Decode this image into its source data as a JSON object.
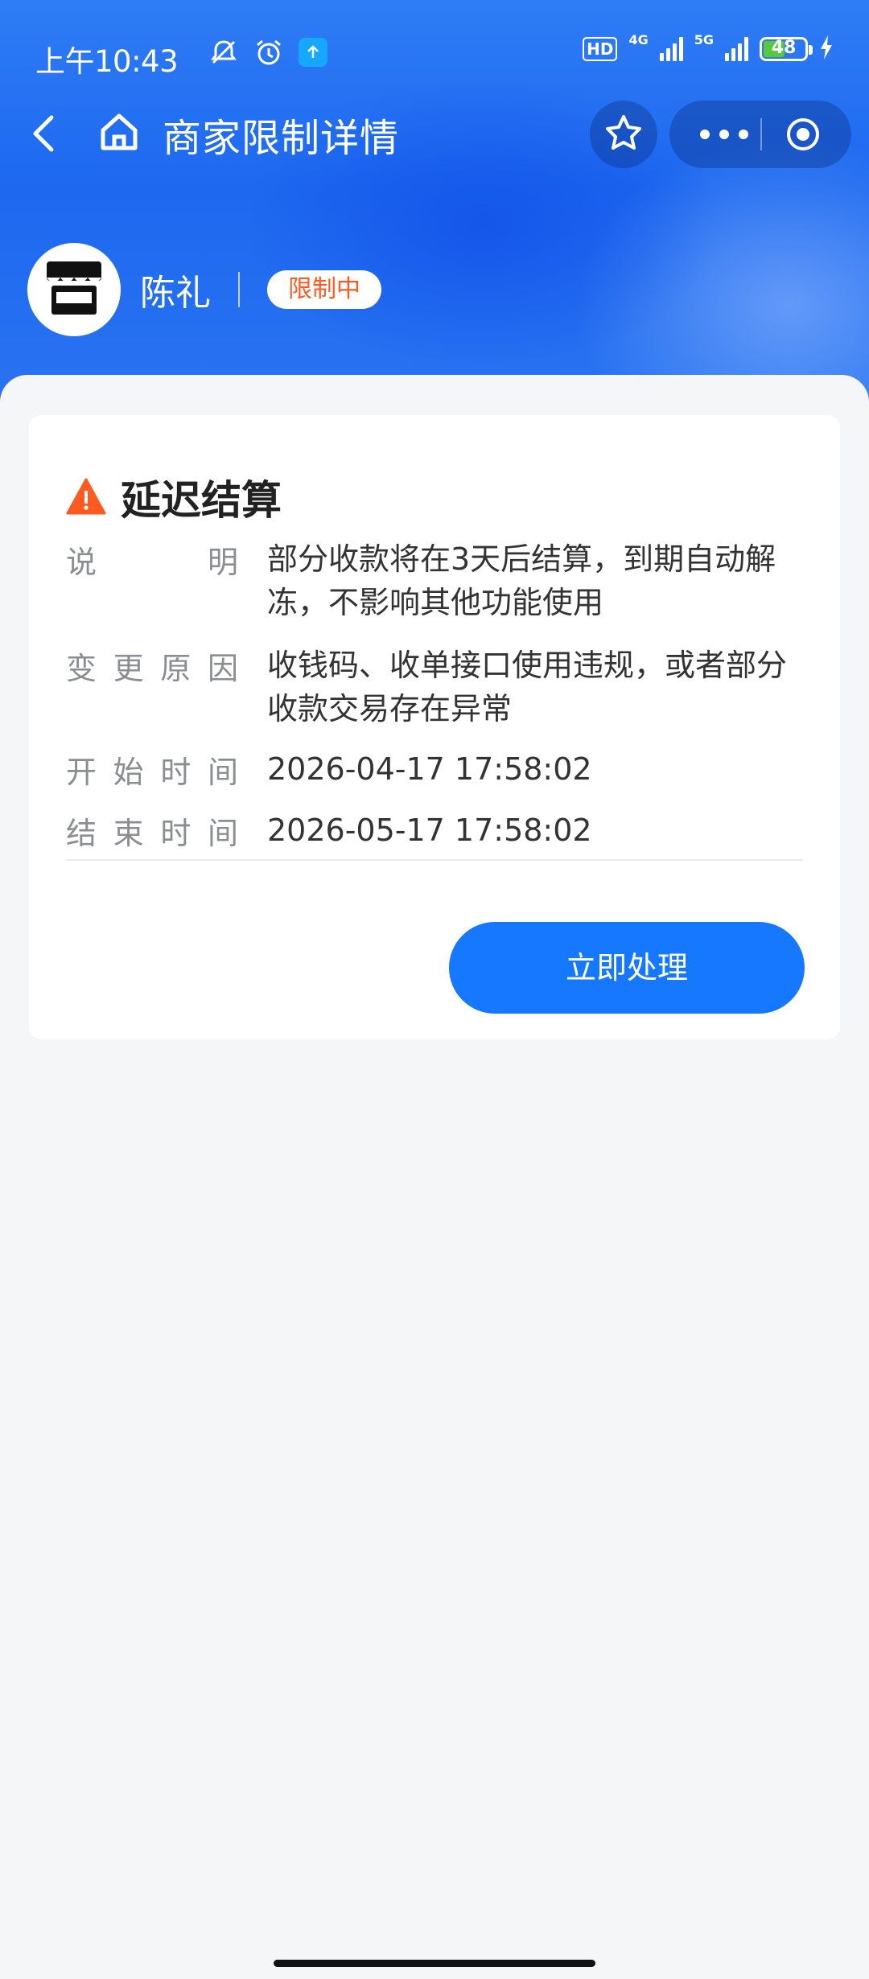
{
  "status_bar": {
    "time": "上午10:43",
    "hd_label": "HD",
    "net1": "4G",
    "net2": "5G",
    "battery": "48"
  },
  "nav": {
    "title": "商家限制详情"
  },
  "merchant": {
    "name": "陈礼",
    "status_badge": "限制中"
  },
  "card": {
    "title": "延迟结算",
    "rows": [
      {
        "label": [
          "说",
          "明"
        ],
        "value": "部分收款将在3天后结算，到期自动解冻，不影响其他功能使用"
      },
      {
        "label": [
          "变",
          "更",
          "原",
          "因"
        ],
        "value": "收钱码、收单接口使用违规，或者部分收款交易存在异常"
      },
      {
        "label": [
          "开",
          "始",
          "时",
          "间"
        ],
        "value": "2026-04-17 17:58:02"
      },
      {
        "label": [
          "结",
          "束",
          "时",
          "间"
        ],
        "value": "2026-05-17 17:58:02"
      }
    ],
    "action_button": "立即处理"
  },
  "colors": {
    "primary": "#1677ff",
    "warning": "#ff5a1f",
    "header_blue": "#1d68ef"
  },
  "icons": [
    "back-icon",
    "home-icon",
    "star-icon",
    "more-icon",
    "target-icon",
    "store-icon",
    "warning-icon"
  ]
}
